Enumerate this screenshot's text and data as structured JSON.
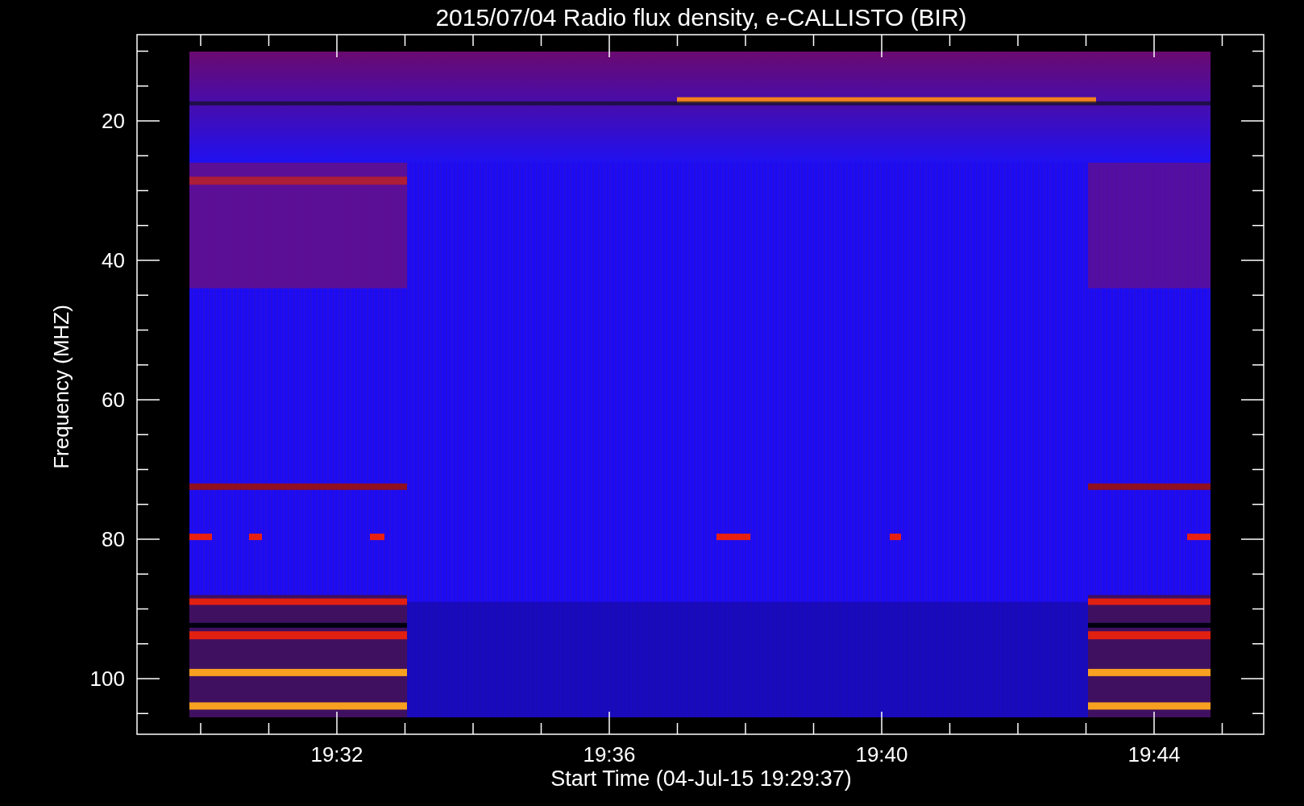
{
  "title": "2015/07/04  Radio flux density, e-CALLISTO (BIR)",
  "y_axis": {
    "label": "Frequency (MHZ)",
    "ticks": [
      "20",
      "40",
      "60",
      "80",
      "100"
    ]
  },
  "x_axis": {
    "label": "Start Time (04-Jul-15 19:29:37)",
    "ticks": [
      "19:32",
      "19:36",
      "19:40",
      "19:44"
    ]
  }
}
